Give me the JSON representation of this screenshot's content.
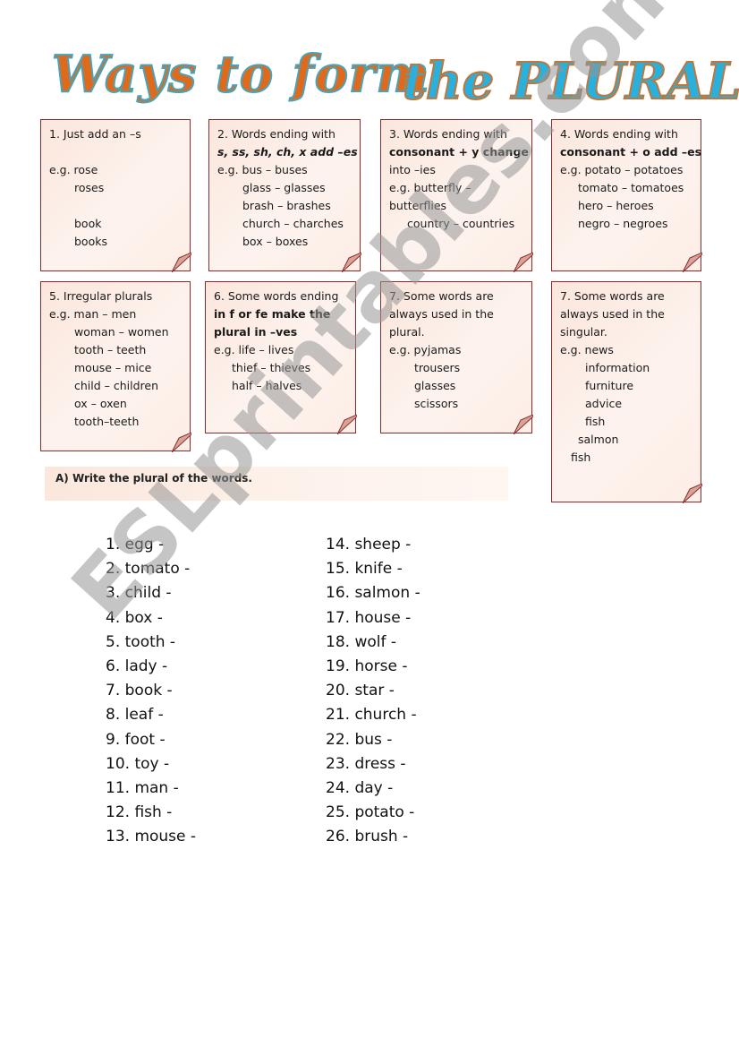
{
  "title": {
    "part1": "Ways to form",
    "part2": "the PLURAL"
  },
  "colors": {
    "title_orange": "#e06a1c",
    "title_blue": "#2ab0dc",
    "note_border": "#8a2a2a",
    "note_fill": "#fbe6dc"
  },
  "notes": [
    {
      "lines": [
        "1. Just add an –s",
        "",
        "e.g. rose",
        "roses",
        "",
        "book",
        "books"
      ]
    },
    {
      "lines": [
        "2. Words ending with",
        "s, ss, sh, ch, x add –es",
        "e.g. bus – buses",
        "glass – glasses",
        "brash – brashes",
        "church – charches",
        "box – boxes"
      ]
    },
    {
      "lines": [
        "3. Words ending with",
        "consonant + y change",
        "into –ies",
        "e.g. butterfly –",
        "butterflies",
        "country – countries"
      ]
    },
    {
      "lines": [
        "4. Words ending with",
        "consonant + o add –es",
        "e.g. potato – potatoes",
        "tomato – tomatoes",
        "hero – heroes",
        "negro – negroes"
      ]
    },
    {
      "lines": [
        "5. Irregular plurals",
        "e.g. man – men",
        "woman – women",
        "tooth – teeth",
        "mouse – mice",
        "child – children",
        "ox – oxen",
        "tooth–teeth"
      ]
    },
    {
      "lines": [
        "6. Some words ending",
        "in f or fe make the",
        "plural in –ves",
        "e.g. life – lives",
        "thief – thieves",
        "half – halves"
      ]
    },
    {
      "lines": [
        "7. Some words are",
        "always used in the",
        "plural.",
        "e.g. pyjamas",
        "trousers",
        "glasses",
        "scissors"
      ]
    },
    {
      "lines": [
        "7. Some words are",
        "always used in the",
        "singular.",
        "e.g. news",
        "information",
        "furniture",
        "advice",
        "fish",
        "salmon",
        "fish"
      ]
    }
  ],
  "instruction": "A) Write the plural of the words.",
  "exercise": {
    "left": [
      "1. egg -",
      "2. tomato -",
      "3. child -",
      "4. box -",
      "5. tooth -",
      "6. lady -",
      "7. book -",
      "8. leaf -",
      "9. foot -",
      "10. toy -",
      "11. man -",
      "12. fish -",
      "13. mouse -"
    ],
    "right": [
      "14. sheep -",
      "15. knife -",
      "16. salmon -",
      "17. house -",
      "18. wolf -",
      "19. horse -",
      "20. star -",
      "21. church -",
      "22. bus -",
      "23. dress -",
      "24. day -",
      "25. potato -",
      "26. brush -"
    ]
  },
  "watermark": "ESLprintables.com"
}
